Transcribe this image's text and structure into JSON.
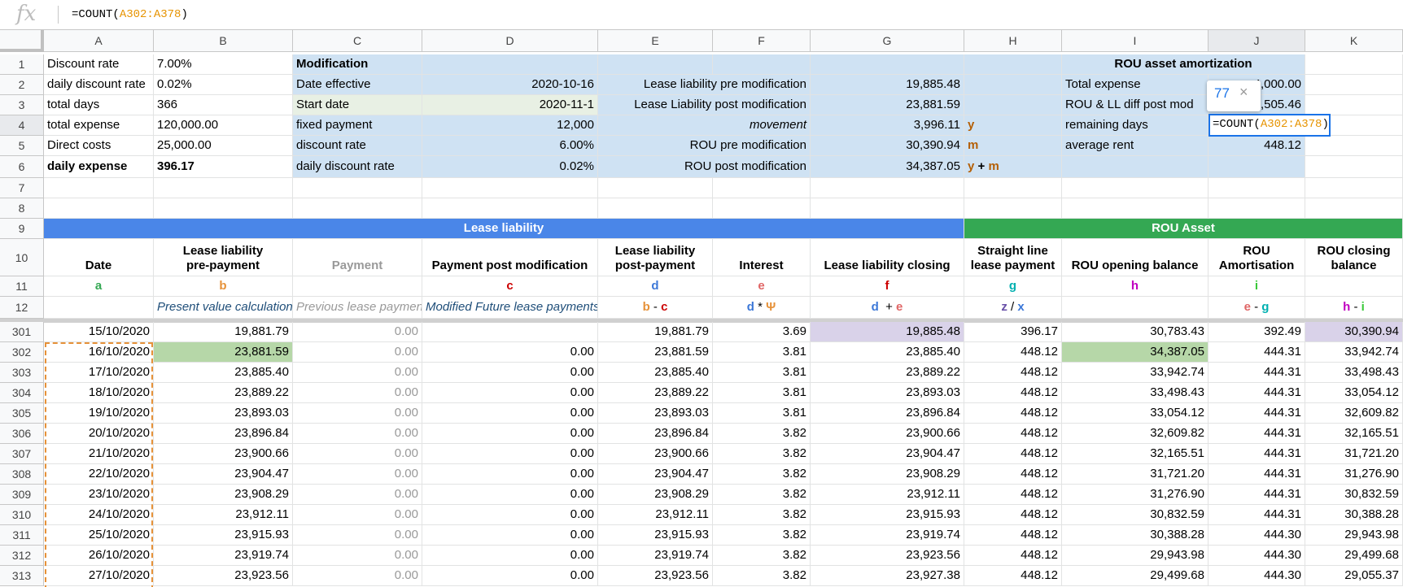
{
  "formula_bar": {
    "icon": "fx-icon",
    "prefix": "=COUNT(",
    "range": "A302:A378",
    "suffix": ")"
  },
  "columns": [
    "A",
    "B",
    "C",
    "D",
    "E",
    "F",
    "G",
    "H",
    "I",
    "J",
    "K"
  ],
  "top_rows": [
    "1",
    "2",
    "3",
    "4",
    "5",
    "6",
    "7",
    "8"
  ],
  "left_params": [
    {
      "label": "Discount rate",
      "value": "7.00%"
    },
    {
      "label": "daily discount rate",
      "value": "0.02%"
    },
    {
      "label": "total days",
      "value": "366"
    },
    {
      "label": "total expense",
      "value": "120,000.00"
    },
    {
      "label": "Direct costs",
      "value": "25,000.00"
    },
    {
      "label": "daily expense",
      "value": "396.17"
    }
  ],
  "modification": {
    "title": "Modification",
    "rows": [
      {
        "label": "Date effective",
        "value": "2020-10-16"
      },
      {
        "label": "Start date",
        "value": "2020-11-1"
      },
      {
        "label": "fixed payment",
        "value": "12,000"
      },
      {
        "label": "discount rate",
        "value": "6.00%"
      },
      {
        "label": "daily discount rate",
        "value": "0.02%"
      }
    ]
  },
  "liability_summary": [
    {
      "label": "Lease liability pre modification",
      "value": "19,885.48",
      "tag": ""
    },
    {
      "label": "Lease Liability post modification",
      "value": "23,881.59",
      "tag": ""
    },
    {
      "label": "movement",
      "value": "3,996.11",
      "tag": "y"
    },
    {
      "label": "ROU pre modification",
      "value": "30,390.94",
      "tag": "m"
    },
    {
      "label": "ROU post modification",
      "value": "34,387.05",
      "tag_a": "y",
      "tag_b": " + ",
      "tag_c": "m"
    }
  ],
  "rou_amort": {
    "title": "ROU asset amortization",
    "rows": [
      {
        "label": "Total expense",
        "value": "4,000.00"
      },
      {
        "label": "ROU & LL diff post mod",
        "value": ",505.46"
      },
      {
        "label": "remaining days",
        "value": ""
      },
      {
        "label": "average rent",
        "value": "448.12"
      }
    ]
  },
  "active_cell": {
    "prefix": "=COUNT(",
    "range": "A302:A378",
    "suffix": ")"
  },
  "tooltip": {
    "value": "77",
    "close": "×"
  },
  "section_headers": {
    "liability": "Lease liability",
    "rou": "ROU Asset"
  },
  "table_headers": [
    "Date",
    "Lease liability\npre-payment",
    "Payment",
    "Payment post modification",
    "Lease liability\npost-payment",
    "Interest",
    "Lease liability closing",
    "Straight line\nlease payment",
    "ROU opening balance",
    "ROU\nAmortisation",
    "ROU closing\nbalance"
  ],
  "letters": [
    "a",
    "b",
    "",
    "c",
    "d",
    "e",
    "f",
    "g",
    "h",
    "i",
    ""
  ],
  "row12": {
    "b": "Present value calculation",
    "c": "Previous lease payments",
    "d": "Modified Future lease payments",
    "e1": "b",
    "e2": " - ",
    "e3": "c",
    "f1": "d",
    "f2": " * ",
    "f3": "Ψ",
    "g1": "d",
    "g2": "  + ",
    "g3": "e",
    "h1": "z",
    "h2": " / ",
    "h3": "x",
    "j1": "e",
    "j2": " - ",
    "j3": "g",
    "k1": "h",
    "k2": " - ",
    "k3": "i"
  },
  "header_row_nums": [
    "9",
    "10",
    "11",
    "12"
  ],
  "data_rows": [
    {
      "n": "301",
      "cells": [
        "15/10/2020",
        "19,881.79",
        "0.00",
        "",
        "19,881.79",
        "3.69",
        "19,885.48",
        "396.17",
        "30,783.43",
        "392.49",
        "30,390.94"
      ]
    },
    {
      "n": "302",
      "cells": [
        "16/10/2020",
        "23,881.59",
        "0.00",
        "0.00",
        "23,881.59",
        "3.81",
        "23,885.40",
        "448.12",
        "34,387.05",
        "444.31",
        "33,942.74"
      ]
    },
    {
      "n": "303",
      "cells": [
        "17/10/2020",
        "23,885.40",
        "0.00",
        "0.00",
        "23,885.40",
        "3.81",
        "23,889.22",
        "448.12",
        "33,942.74",
        "444.31",
        "33,498.43"
      ]
    },
    {
      "n": "304",
      "cells": [
        "18/10/2020",
        "23,889.22",
        "0.00",
        "0.00",
        "23,889.22",
        "3.81",
        "23,893.03",
        "448.12",
        "33,498.43",
        "444.31",
        "33,054.12"
      ]
    },
    {
      "n": "305",
      "cells": [
        "19/10/2020",
        "23,893.03",
        "0.00",
        "0.00",
        "23,893.03",
        "3.81",
        "23,896.84",
        "448.12",
        "33,054.12",
        "444.31",
        "32,609.82"
      ]
    },
    {
      "n": "306",
      "cells": [
        "20/10/2020",
        "23,896.84",
        "0.00",
        "0.00",
        "23,896.84",
        "3.82",
        "23,900.66",
        "448.12",
        "32,609.82",
        "444.31",
        "32,165.51"
      ]
    },
    {
      "n": "307",
      "cells": [
        "21/10/2020",
        "23,900.66",
        "0.00",
        "0.00",
        "23,900.66",
        "3.82",
        "23,904.47",
        "448.12",
        "32,165.51",
        "444.31",
        "31,721.20"
      ]
    },
    {
      "n": "308",
      "cells": [
        "22/10/2020",
        "23,904.47",
        "0.00",
        "0.00",
        "23,904.47",
        "3.82",
        "23,908.29",
        "448.12",
        "31,721.20",
        "444.31",
        "31,276.90"
      ]
    },
    {
      "n": "309",
      "cells": [
        "23/10/2020",
        "23,908.29",
        "0.00",
        "0.00",
        "23,908.29",
        "3.82",
        "23,912.11",
        "448.12",
        "31,276.90",
        "444.31",
        "30,832.59"
      ]
    },
    {
      "n": "310",
      "cells": [
        "24/10/2020",
        "23,912.11",
        "0.00",
        "0.00",
        "23,912.11",
        "3.82",
        "23,915.93",
        "448.12",
        "30,832.59",
        "444.31",
        "30,388.28"
      ]
    },
    {
      "n": "311",
      "cells": [
        "25/10/2020",
        "23,915.93",
        "0.00",
        "0.00",
        "23,915.93",
        "3.82",
        "23,919.74",
        "448.12",
        "30,388.28",
        "444.30",
        "29,943.98"
      ]
    },
    {
      "n": "312",
      "cells": [
        "26/10/2020",
        "23,919.74",
        "0.00",
        "0.00",
        "23,919.74",
        "3.82",
        "23,923.56",
        "448.12",
        "29,943.98",
        "444.30",
        "29,499.68"
      ]
    },
    {
      "n": "313",
      "cells": [
        "27/10/2020",
        "23,923.56",
        "0.00",
        "0.00",
        "23,923.56",
        "3.82",
        "23,927.38",
        "448.12",
        "29,499.68",
        "444.30",
        "29,055.37"
      ]
    }
  ],
  "colors": {
    "accent_blue": "#4a86e8",
    "accent_green": "#34a853",
    "light_blue": "#cfe2f3",
    "lilac": "#d9d2e9",
    "light_green": "#b6d7a8",
    "selection": "#1a73e8",
    "copy_border": "#e69138"
  }
}
